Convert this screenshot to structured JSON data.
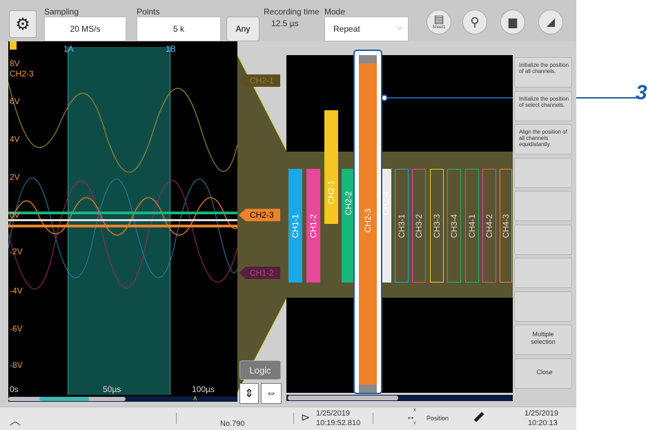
{
  "top": {
    "sampling_label": "Sampling",
    "sampling_value": "20 MS/s",
    "points_label": "Points",
    "points_value": "5 k",
    "any_label": "Any",
    "recording_time_label": "Recording time",
    "recording_time_value": "12.5 µs",
    "mode_label": "Mode",
    "mode_value": "Repeat",
    "sheet_label": "Sheet1"
  },
  "wave": {
    "cursor_a": "1A",
    "cursor_b": "1B",
    "channel_label": "CH2-3",
    "y_labels": [
      "8V",
      "6V",
      "4V",
      "2V",
      "0V",
      "-2V",
      "-4V",
      "-6V",
      "-8V"
    ],
    "x_labels": [
      "0s",
      "50µs",
      "100µs"
    ],
    "scroll_label": "A"
  },
  "markers": {
    "m1": "CH2-1",
    "m2": "CH2-3",
    "m3": "CH1-2"
  },
  "buttons": {
    "logic": "Logic"
  },
  "channels": [
    {
      "name": "CH1-1",
      "color": "#1aa9e6"
    },
    {
      "name": "CH1-2",
      "color": "#e8479a"
    },
    {
      "name": "CH2-1",
      "color": "#f7c623"
    },
    {
      "name": "CH2-2",
      "color": "#17b67a"
    },
    {
      "name": "CH2-3",
      "color": "#f0832a"
    },
    {
      "name": "CH2-4",
      "color": "#ececec"
    },
    {
      "name": "CH3-1",
      "color": "#1aa9e6"
    },
    {
      "name": "CH3-2",
      "color": "#e8479a"
    },
    {
      "name": "CH3-3",
      "color": "#f7c623"
    },
    {
      "name": "CH3-4",
      "color": "#17b67a"
    },
    {
      "name": "CH4-1",
      "color": "#17b67a"
    },
    {
      "name": "CH4-2",
      "color": "#e8479a"
    },
    {
      "name": "CH4-3",
      "color": "#f0832a"
    }
  ],
  "panel": {
    "init_all": "Initialize the position of all channels.",
    "init_select": "Initialize the position of select channels.",
    "align_all": "Align the position of all channels equidistantly.",
    "multiple": "Multiple selection",
    "close": "Close"
  },
  "callout": "3",
  "bottom": {
    "number": "No.790",
    "trigger_date": "1/25/2019",
    "trigger_time": "10:19:52.810",
    "position_label": "Position",
    "pos_x": "X",
    "pos_y": "Y",
    "clock_date": "1/25/2019",
    "clock_time": "10:20:13"
  }
}
